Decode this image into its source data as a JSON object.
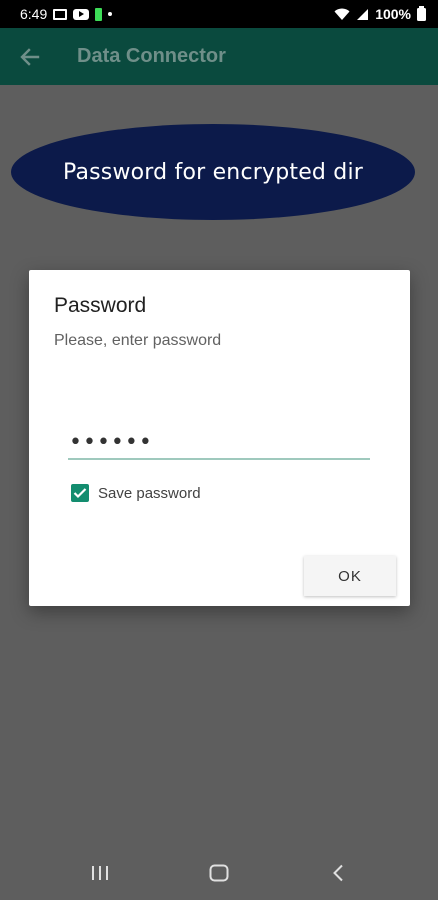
{
  "status_bar": {
    "time": "6:49",
    "battery_percent": "100%",
    "icons": [
      "image-icon",
      "youtube-icon",
      "battery-charging-icon",
      "dot-icon",
      "wifi-icon",
      "signal-icon",
      "battery-icon"
    ]
  },
  "app_bar": {
    "title": "Data Connector",
    "back_icon": "arrow-left-icon"
  },
  "banner": {
    "text": "Password for encrypted dir"
  },
  "dialog": {
    "title": "Password",
    "message": "Please, enter password",
    "password_value": "••••••",
    "save_password_label": "Save password",
    "save_password_checked": true,
    "ok_label": "OK"
  },
  "nav_bar": {
    "icons": [
      "recents-icon",
      "home-icon",
      "back-icon"
    ]
  },
  "colors": {
    "app_bar": "#0a4a3e",
    "accent": "#138d6f",
    "banner": "#0c1a4a",
    "scrim": "#5e5e5e"
  }
}
